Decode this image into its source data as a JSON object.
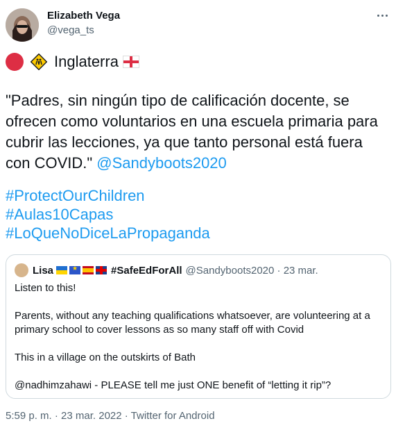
{
  "tweet": {
    "author_name": "Elizabeth Vega",
    "author_handle": "@vega_ts",
    "location_text": "Inglaterra",
    "body_text": "\"Padres, sin ningún tipo de calificación docente, se ofrecen como voluntarios en una escuela primaria para cubrir las lecciones, ya que tanto personal está fuera con COVID.\" ",
    "mention": "@Sandyboots2020",
    "hashtags": [
      "#ProtectOurChildren",
      "#Aulas10Capas",
      "#LoQueNoDiceLaPropaganda"
    ],
    "footer": "5:59 p. m. · 23 mar. 2022 · Twitter for Android"
  },
  "quote": {
    "name": "Lisa",
    "hashtag": "#SafeEdForAll",
    "meta": "@Sandyboots2020 · 23 mar.",
    "body": "Listen to this!\n\nParents, without any teaching qualifications whatsoever, are volunteering at a primary school to cover lessons as so many staff off with Covid\n\nThis in a village on the outskirts of Bath\n\n@nadhimzahawi - PLEASE tell me just ONE benefit of “letting it rip”?"
  },
  "icons": [
    "red-circle-icon",
    "children-crossing-icon",
    "england-flag-icon",
    "more-options-icon"
  ],
  "colors": {
    "link": "#1d9bf0",
    "secondary": "#536471",
    "border": "#cfd9de"
  }
}
